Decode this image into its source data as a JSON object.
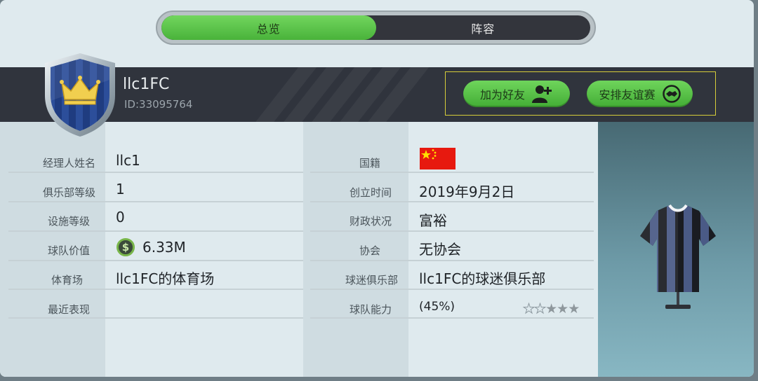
{
  "tabs": [
    {
      "label": "总览",
      "active": true
    },
    {
      "label": "阵容",
      "active": false
    }
  ],
  "club": {
    "name": "llc1FC",
    "id_text": "ID:33095764"
  },
  "actions": {
    "add_friend": "加为好友",
    "friendly_match": "安排友谊赛"
  },
  "left_info": [
    {
      "label": "经理人姓名",
      "value": "llc1"
    },
    {
      "label": "俱乐部等级",
      "value": "1"
    },
    {
      "label": "设施等级",
      "value": "0"
    },
    {
      "label": "球队价值",
      "value": "6.33M",
      "icon": "dollar-coin-icon"
    },
    {
      "label": "体育场",
      "value": "llc1FC的体育场"
    },
    {
      "label": "最近表现",
      "value": ""
    }
  ],
  "right_info": [
    {
      "label": "国籍",
      "value": "",
      "icon": "china-flag-icon"
    },
    {
      "label": "创立时间",
      "value": "2019年9月2日"
    },
    {
      "label": "财政状况",
      "value": "富裕"
    },
    {
      "label": "协会",
      "value": "无协会"
    },
    {
      "label": "球迷俱乐部",
      "value": "llc1FC的球迷俱乐部"
    },
    {
      "label": "球队能力",
      "value": "(45%)"
    }
  ],
  "team_ability_stars": {
    "filled": 3,
    "total": 5
  },
  "coin_symbol": "$",
  "colors": {
    "accent_green": "#4bb53c",
    "header_dark": "#30343d",
    "flag_red": "#e7190f",
    "flag_yellow": "#ffde00"
  }
}
